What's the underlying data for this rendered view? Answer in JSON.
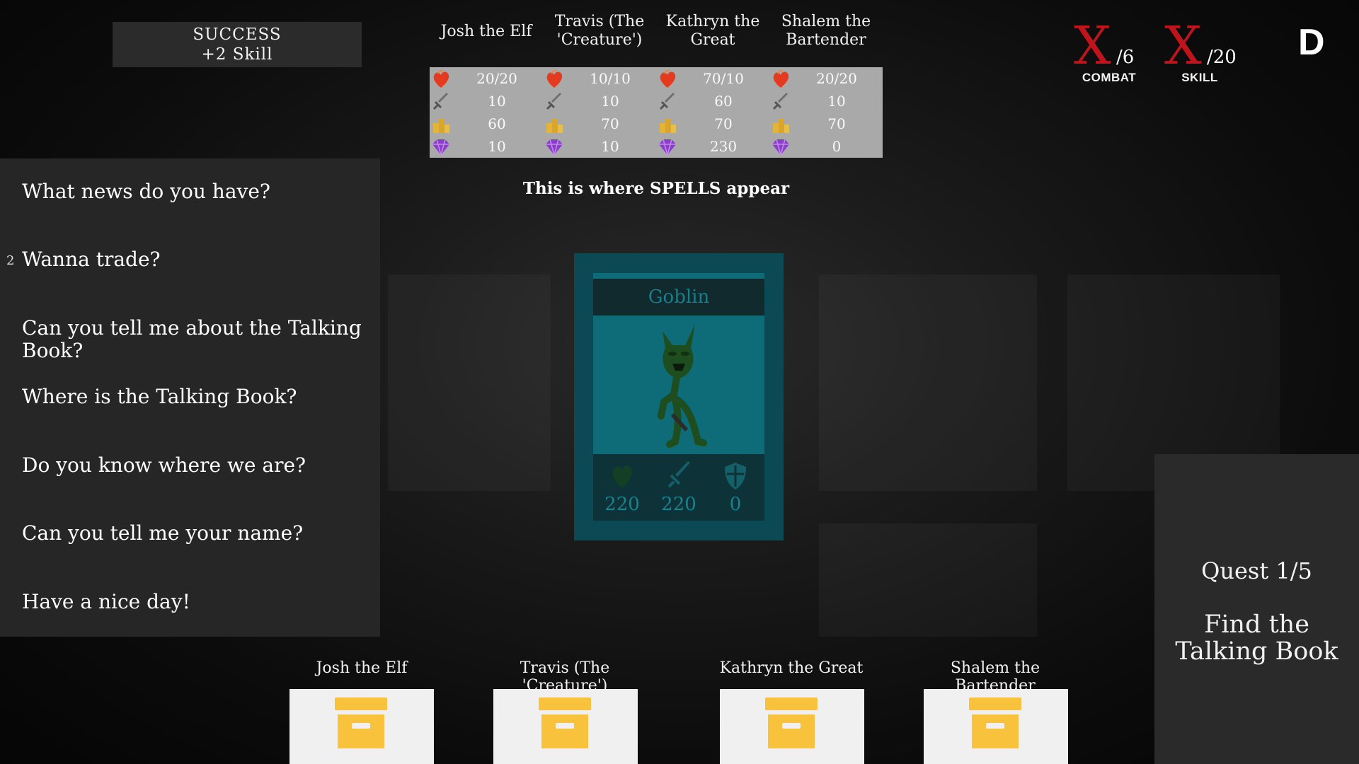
{
  "result": {
    "title": "SUCCESS",
    "detail": "+2 Skill"
  },
  "party": [
    {
      "name": "Josh the Elf",
      "health": "20/20",
      "attack": "10",
      "gold": "60",
      "gems": "10"
    },
    {
      "name": "Travis (The 'Creature')",
      "health": "10/10",
      "attack": "10",
      "gold": "70",
      "gems": "10"
    },
    {
      "name": "Kathryn the Great",
      "health": "70/10",
      "attack": "60",
      "gold": "70",
      "gems": "230"
    },
    {
      "name": "Shalem the Bartender",
      "health": "20/20",
      "attack": "10",
      "gold": "70",
      "gems": "0"
    }
  ],
  "stat_icons": [
    "heart-icon",
    "sword-icon",
    "gold-coins-icon",
    "gem-icon"
  ],
  "spells_placeholder": "This is where SPELLS appear",
  "dialogue": {
    "selected_number": "2",
    "options": [
      "What news do you have?",
      "Wanna trade?",
      "Can you tell me about the Talking Book?",
      "Where is the Talking Book?",
      "Do you know where we are?",
      "Can you tell me your name?",
      "Have a nice day!"
    ]
  },
  "counters": {
    "combat": {
      "mark": "X",
      "max": "/6",
      "label": "COMBAT"
    },
    "skill": {
      "mark": "X",
      "max": "/20",
      "label": "SKILL"
    }
  },
  "difficulty": "D",
  "enemy": {
    "name": "Goblin",
    "health": "220",
    "attack": "220",
    "defense": "0"
  },
  "quest": {
    "count": "Quest 1/5",
    "description": "Find the Talking Book"
  },
  "inventory": [
    {
      "name": "Josh the Elf"
    },
    {
      "name": "Travis (The 'Creature')"
    },
    {
      "name": "Kathryn the Great"
    },
    {
      "name": "Shalem the Bartender"
    }
  ],
  "colors": {
    "accent_red": "#c0141c",
    "card_teal": "#0e6b78",
    "box_yellow": "#f9c23c",
    "gem_purple": "#8a3fc8"
  }
}
